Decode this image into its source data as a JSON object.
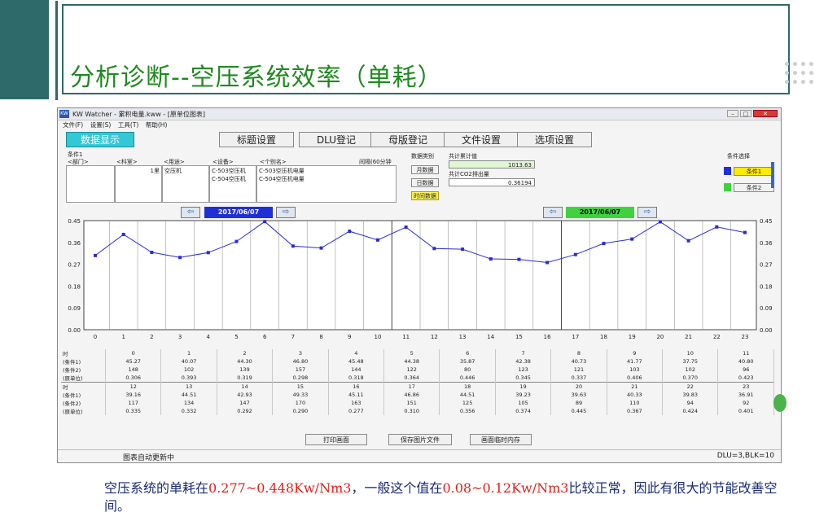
{
  "slide": {
    "title": "分析诊断--空压系统效率（单耗）",
    "footnote_parts": [
      "空压系统的单耗在",
      "0.277~0.448Kw/Nm3",
      "，一般这个值在",
      "0.08~0.12Kw/Nm3",
      "比较正常，因此有很大的节能改善空间。"
    ]
  },
  "window": {
    "title": "KW Watcher - 累积电量.kww - [原单位图表]",
    "menu": [
      "文件(F)",
      "设置(S)",
      "工具(T)",
      "帮助(H)"
    ],
    "toolbar": [
      "数据显示",
      "标题设置",
      "DLU登记",
      "母版登记",
      "文件设置",
      "选项设置"
    ],
    "info": {
      "condition_label": "条件1",
      "col_headers": [
        "<部门>",
        "<科室>",
        "<用途>",
        "<设备>",
        "<个别名>"
      ],
      "dept_val": "",
      "section_val": "1里",
      "usage_val": "空压机",
      "devices": [
        "C-503空压机",
        "C-504空压机"
      ],
      "names": [
        "C-503空压机电量",
        "C-504空压机电量"
      ],
      "interval": "间隔(60分钟",
      "data_type_label": "数据类别",
      "data_types": [
        "月数据",
        "日数据",
        "时间数据"
      ],
      "total_label": "共计累计值",
      "total_value": "1013.63",
      "co2_label": "共计CO2排出量",
      "co2_value": "0.36194",
      "cond_select_label": "条件选择",
      "cond_buttons": [
        "条件1",
        "条件2"
      ]
    },
    "nav": {
      "date_left": "2017/06/07",
      "date_right": "2017/06/07"
    },
    "chart_data": {
      "type": "line",
      "x": [
        0,
        1,
        2,
        3,
        4,
        5,
        6,
        7,
        8,
        9,
        10,
        11,
        12,
        13,
        14,
        15,
        16,
        17,
        18,
        19,
        20,
        21,
        22,
        23
      ],
      "series": [
        {
          "values": [
            0.306,
            0.393,
            0.319,
            0.298,
            0.318,
            0.364,
            0.446,
            0.345,
            0.337,
            0.406,
            0.37,
            0.423,
            0.335,
            0.332,
            0.292,
            0.29,
            0.277,
            0.31,
            0.356,
            0.374,
            0.445,
            0.367,
            0.424,
            0.401
          ]
        }
      ],
      "y_ticks": [
        "0.45",
        "0.36",
        "0.27",
        "0.18",
        "0.09",
        "0.00"
      ],
      "ylim": [
        0,
        0.45
      ],
      "grid": true,
      "series_color": "#2b2bd8"
    },
    "table": {
      "row_labels": [
        "时",
        "(条件1)",
        "(条件2)",
        "(原单位)"
      ],
      "blocks": [
        {
          "hours": [
            "0",
            "1",
            "2",
            "3",
            "4",
            "5",
            "6",
            "7",
            "8",
            "9",
            "10",
            "11"
          ],
          "c1": [
            "45.27",
            "40.07",
            "44.30",
            "46.80",
            "45.48",
            "44.38",
            "35.87",
            "42.38",
            "40.73",
            "41.77",
            "37.75",
            "40.80"
          ],
          "c2": [
            "148",
            "102",
            "139",
            "157",
            "144",
            "122",
            "80",
            "123",
            "121",
            "103",
            "102",
            "96"
          ],
          "unit": [
            "0.306",
            "0.393",
            "0.319",
            "0.298",
            "0.318",
            "0.364",
            "0.446",
            "0.345",
            "0.337",
            "0.406",
            "0.370",
            "0.423"
          ]
        },
        {
          "hours": [
            "12",
            "13",
            "14",
            "15",
            "16",
            "17",
            "18",
            "19",
            "20",
            "21",
            "22",
            "23"
          ],
          "c1": [
            "39.16",
            "44.51",
            "42.93",
            "49.33",
            "45.11",
            "46.86",
            "44.51",
            "39.23",
            "39.63",
            "40.33",
            "39.83",
            "36.91"
          ],
          "c2": [
            "117",
            "134",
            "147",
            "170",
            "163",
            "151",
            "125",
            "105",
            "89",
            "110",
            "94",
            "92"
          ],
          "unit": [
            "0.335",
            "0.332",
            "0.292",
            "0.290",
            "0.277",
            "0.310",
            "0.356",
            "0.374",
            "0.445",
            "0.367",
            "0.424",
            "0.401"
          ]
        }
      ]
    },
    "bottom_buttons": [
      "打印画面",
      "保存图片文件",
      "画面临时内存"
    ],
    "status_left": "图表自动更新中",
    "status_right": "DLU=3,BLK=10"
  }
}
